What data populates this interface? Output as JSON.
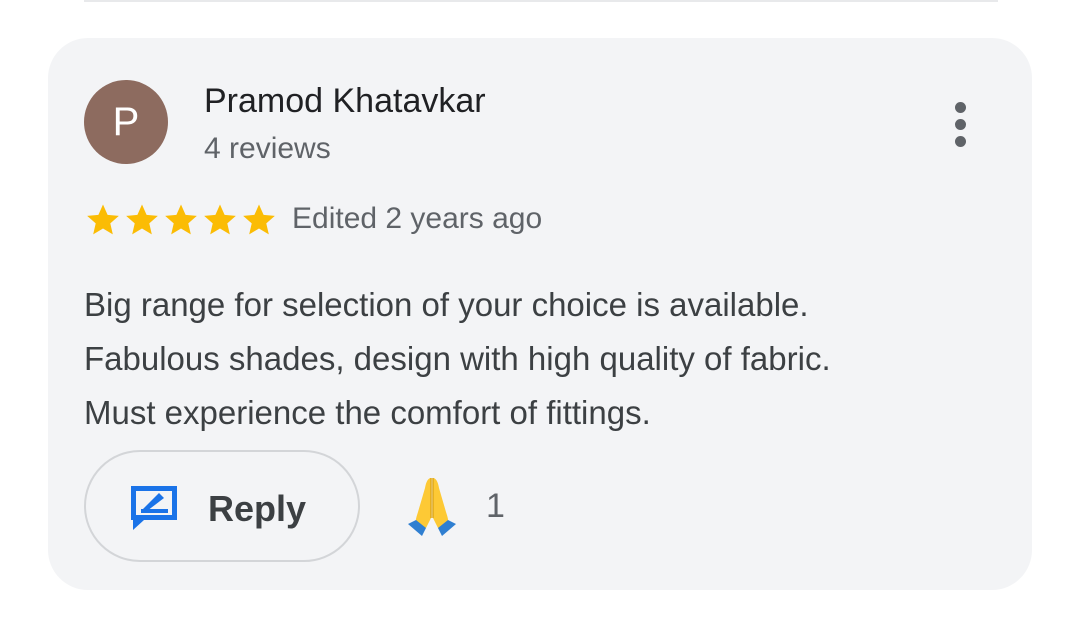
{
  "review": {
    "author_initial": "P",
    "author_name": "Pramod Khatavkar",
    "review_count": "4 reviews",
    "rating": 5,
    "rating_max": 5,
    "edited": "Edited 2 years ago",
    "text_lines": [
      "Big range for selection of your choice is available.",
      "Fabulous shades, design with high quality of fabric.",
      "Must experience the comfort of fittings."
    ],
    "reply_label": "Reply",
    "reaction_emoji": "pray-icon",
    "reaction_count": "1"
  },
  "colors": {
    "card_background": "#f3f4f6",
    "avatar_background": "#8d6b5f",
    "star": "#fbbc04",
    "reply_icon": "#1a73e8",
    "pray_hands": "#fdc935",
    "pray_sleeves": "#2f7fd1"
  }
}
